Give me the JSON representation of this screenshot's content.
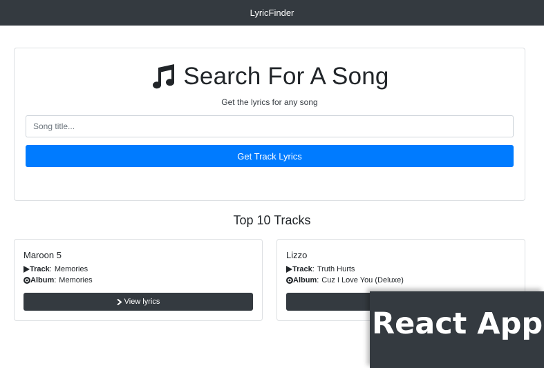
{
  "navbar": {
    "brand": "LyricFinder"
  },
  "search": {
    "icon": "music-note-icon",
    "title": "Search For A Song",
    "subtitle": "Get the lyrics for any song",
    "input_placeholder": "Song title...",
    "input_value": "",
    "submit_label": "Get Track Lyrics"
  },
  "tracks_section": {
    "heading": "Top 10 Tracks",
    "track_prefix": "Track",
    "album_prefix": "Album",
    "button_label": "View lyrics",
    "items": [
      {
        "artist": "Maroon 5",
        "track": "Memories",
        "album": "Memories"
      },
      {
        "artist": "Lizzo",
        "track": "Truth Hurts",
        "album": "Cuz I Love You (Deluxe)"
      }
    ]
  },
  "overlay": {
    "label": "React App"
  },
  "colors": {
    "navbar": "#343a40",
    "primary": "#007bff",
    "dark_button": "#343a40"
  }
}
